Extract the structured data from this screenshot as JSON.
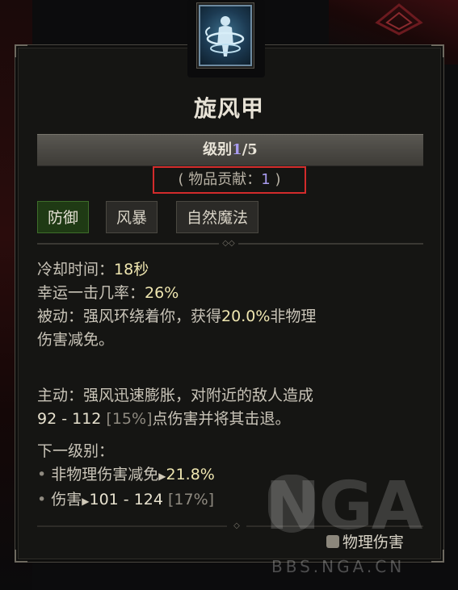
{
  "skill": {
    "title": "旋风甲",
    "level_prefix": "级别",
    "level_current": "1",
    "level_max": "/5",
    "contrib_prefix": "( 物品贡献：",
    "contrib_value": "1",
    "contrib_suffix": " )",
    "icon": "whirlwind-armor-skill-icon"
  },
  "tags": [
    "防御",
    "风暴",
    "自然魔法"
  ],
  "stats": {
    "cooldown_label": "冷却时间：",
    "cooldown_value": "18秒",
    "lucky_label": "幸运一击几率：",
    "lucky_value": "26%"
  },
  "passive": {
    "line1_a": "被动：强风环绕着你，获得",
    "line1_val": "20.0%",
    "line1_b": "非物理",
    "line2": "伤害减免。"
  },
  "active": {
    "line1": "主动：强风迅速膨胀，对附近的敌人造成",
    "dmg": "92 - 112",
    "pct": " [15%]",
    "line2_rest": "点伤害并将其击退。"
  },
  "next_level": {
    "label": "下一级别：",
    "item1_label": "非物理伤害减免",
    "item1_val": "21.8%",
    "item2_label": "伤害",
    "item2_val": "101 - 124",
    "item2_pct": " [17%]"
  },
  "footer": {
    "damage_type": "物理伤害",
    "icon": "fist-icon"
  },
  "watermark": {
    "text": "NGA",
    "url": "BBS.NGA.CN"
  },
  "colors": {
    "level_accent": "#a99cf0",
    "highlight_box": "#d22b2b",
    "active_tag": "#1f3a14",
    "value_yellow": "#efe6b0"
  }
}
